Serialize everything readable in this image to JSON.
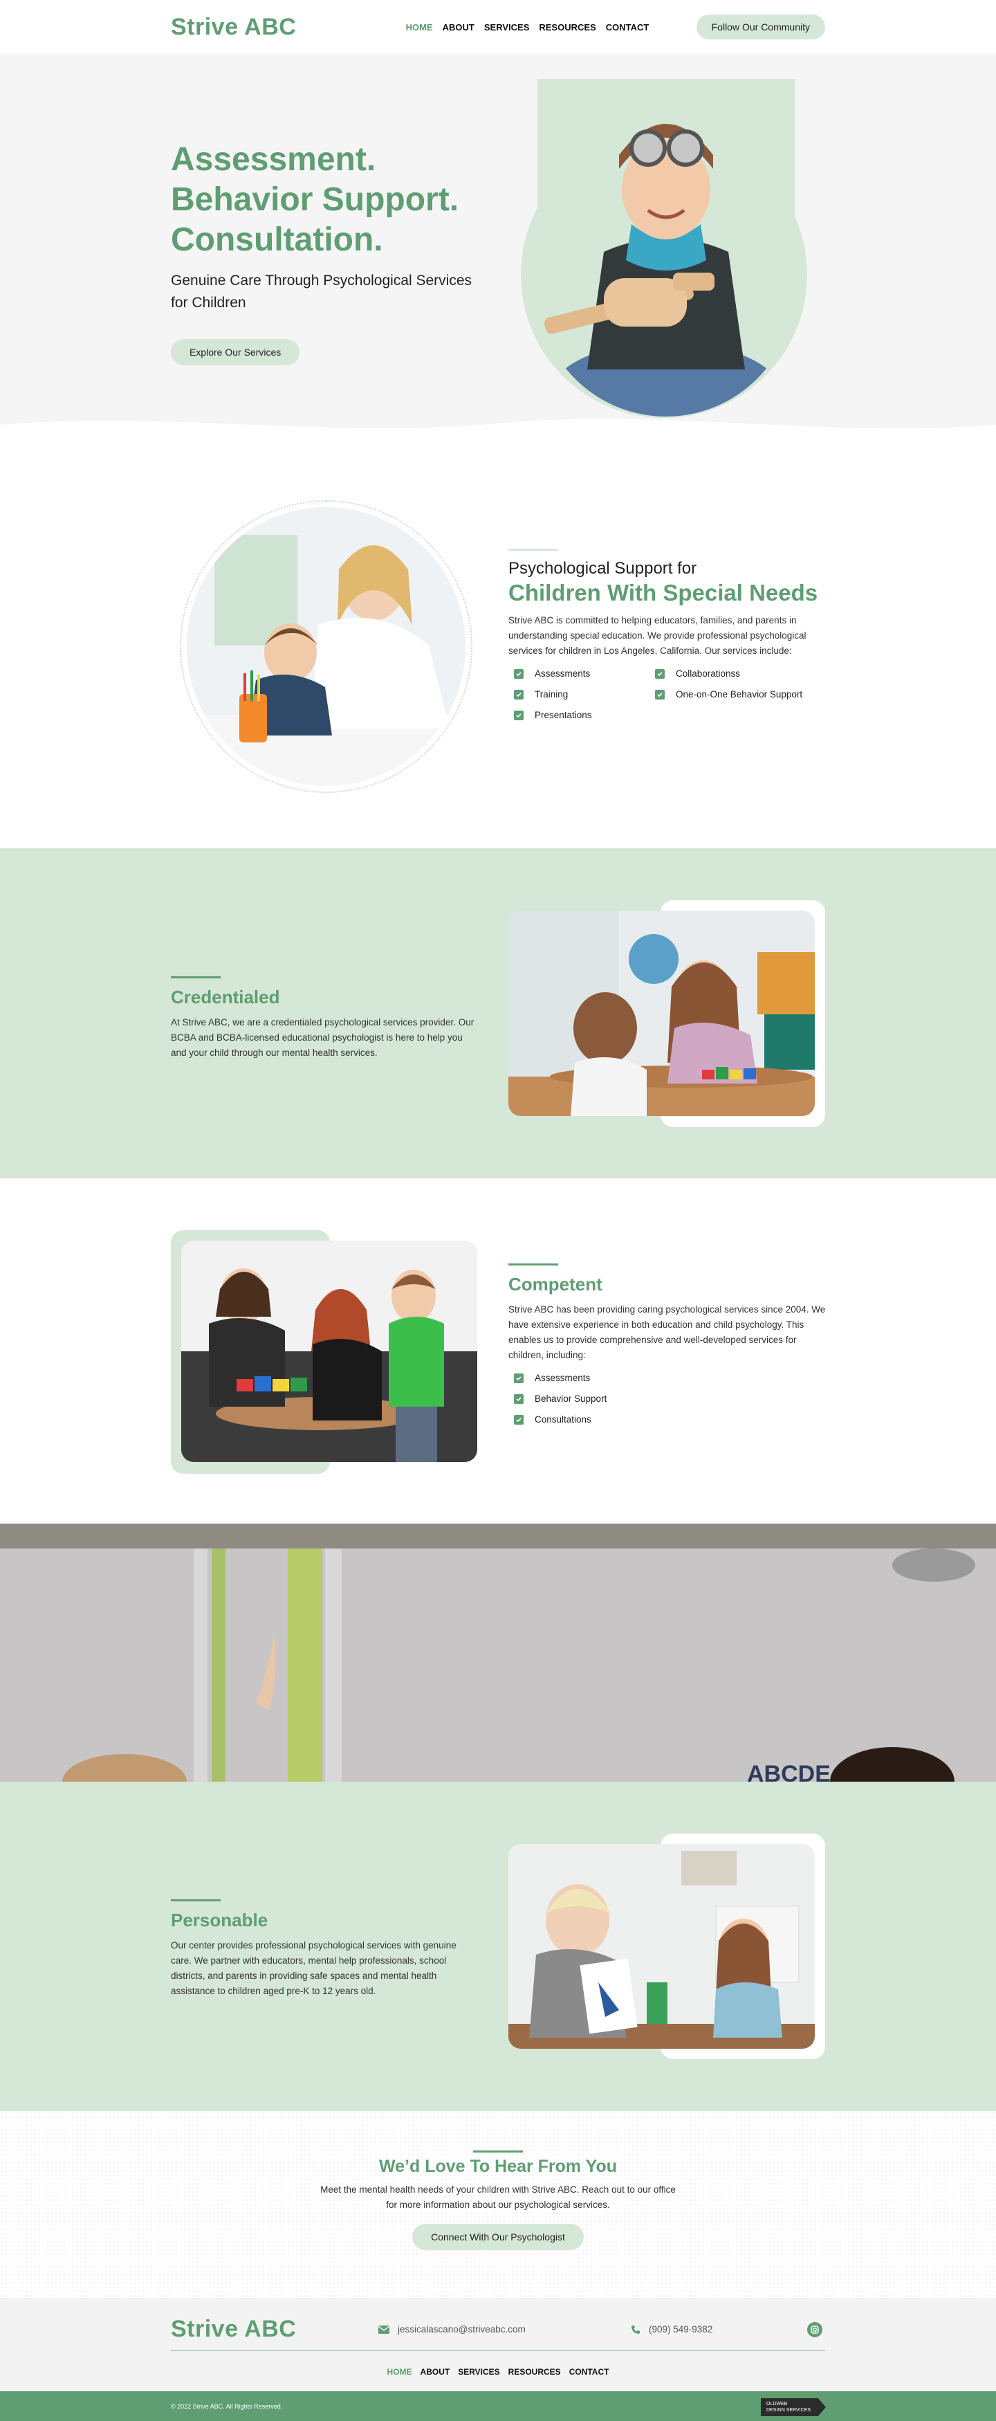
{
  "brand": {
    "name": "Strive ABC",
    "accent": "#5e9e72",
    "light": "#d5e7d6"
  },
  "nav": {
    "items": [
      {
        "label": "HOME",
        "active": true
      },
      {
        "label": "ABOUT"
      },
      {
        "label": "SERVICES"
      },
      {
        "label": "RESOURCES"
      },
      {
        "label": "CONTACT"
      }
    ],
    "cta": "Follow Our Community"
  },
  "hero": {
    "title_line1": "Assessment.",
    "title_line2": "Behavior Support.",
    "title_line3": "Consultation.",
    "subtitle": "Genuine Care Through Psychological Services for Children",
    "button": "Explore Our Services"
  },
  "support": {
    "kicker": "Psychological Support for",
    "title": "Children With Special Needs",
    "paragraph": "Strive ABC is committed to helping educators, families, and parents in understanding special education. We provide professional psychological services for children in Los Angeles, California. Our services include:",
    "items": [
      "Assessments",
      "Collaborationss",
      "Training",
      "One-on-One Behavior Support",
      "Presentations"
    ]
  },
  "credentialed": {
    "title": "Credentialed",
    "paragraph": "At Strive ABC, we are a credentialed psychological services provider. Our BCBA and BCBA-licensed educational psychologist is here to help you and your child through our mental health services."
  },
  "competent": {
    "title": "Competent",
    "paragraph": "Strive ABC has been providing caring psychological services since 2004. We have extensive experience in both education and child psychology. This enables us to provide comprehensive and well-developed services for children, including:",
    "items": [
      "Assessments",
      "Behavior Support",
      "Consultations"
    ]
  },
  "banner": {
    "letters": "ABCDE"
  },
  "personable": {
    "title": "Personable",
    "paragraph": "Our center provides professional psychological services with genuine care. We partner with educators, mental help professionals, school districts, and parents in providing safe spaces and mental health assistance to children aged pre-K to 12 years old."
  },
  "contact": {
    "title": "We’d Love To Hear From You",
    "paragraph": "Meet the mental health needs of your children with Strive ABC. Reach out to our office for more information about our psychological services.",
    "button": "Connect With Our Psychologist"
  },
  "footer": {
    "logo": "Strive ABC",
    "email": "jessicalascano@striveabc.com",
    "phone": "(909) 549-9382",
    "nav": [
      "HOME",
      "ABOUT",
      "SERVICES",
      "RESOURCES",
      "CONTACT"
    ],
    "copyright": "© 2022 Strive ABC. All Rights Reserved.",
    "badge_line1": "OLDWEB",
    "badge_line2": "DESIGN SERVICES"
  }
}
